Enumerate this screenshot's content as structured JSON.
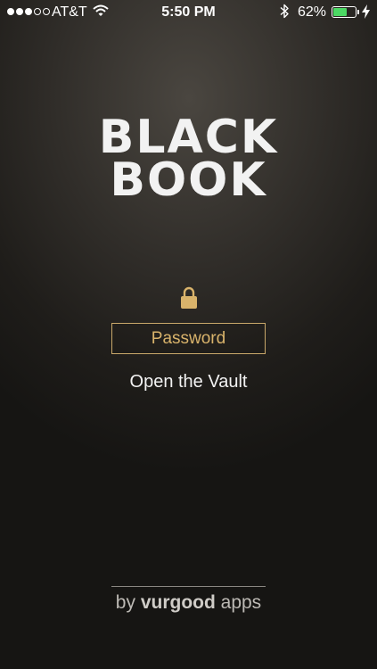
{
  "status_bar": {
    "signal_bars_filled": 3,
    "signal_bars_total": 5,
    "carrier": "AT&T",
    "wifi_icon": "wifi-icon",
    "time": "5:50 PM",
    "bluetooth_icon": "bluetooth-icon",
    "battery_percent": "62%",
    "battery_level": 0.62,
    "battery_color": "#4cd964",
    "charging_icon": "bolt-icon"
  },
  "logo": {
    "line1": "BLACK",
    "line2": "BOOK"
  },
  "lock_icon": "lock-icon",
  "lock_color": "#d9b36b",
  "password": {
    "placeholder": "Password",
    "value": ""
  },
  "open_button_label": "Open the Vault",
  "credit": {
    "prefix": "by ",
    "brand": "vurgood",
    "suffix": " apps"
  }
}
